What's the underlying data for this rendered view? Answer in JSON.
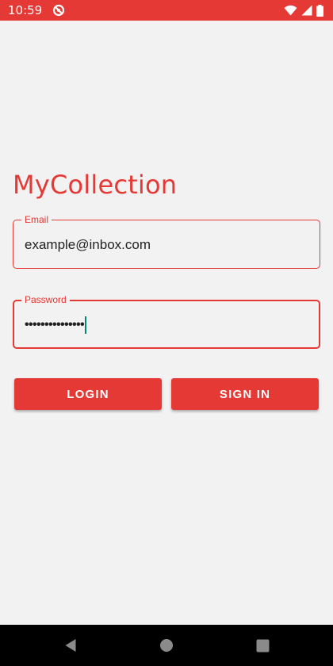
{
  "status_bar": {
    "time": "10:59",
    "icons": [
      "notification-icon",
      "wifi-icon",
      "cell-signal-icon",
      "battery-icon"
    ]
  },
  "app": {
    "title": "MyCollection"
  },
  "login_form": {
    "email": {
      "label": "Email",
      "value": "example@inbox.com"
    },
    "password": {
      "label": "Password",
      "masked_value": "•••••••••••••••",
      "focused": true
    },
    "login_label": "LOGIN",
    "signin_label": "SIGN IN"
  },
  "nav_bar": {
    "icons": [
      "back-icon",
      "home-icon",
      "recents-icon"
    ]
  },
  "colors": {
    "accent": "#e53935",
    "background": "#f2f2f2",
    "caret": "#00897b",
    "nav_bar": "#000000"
  }
}
